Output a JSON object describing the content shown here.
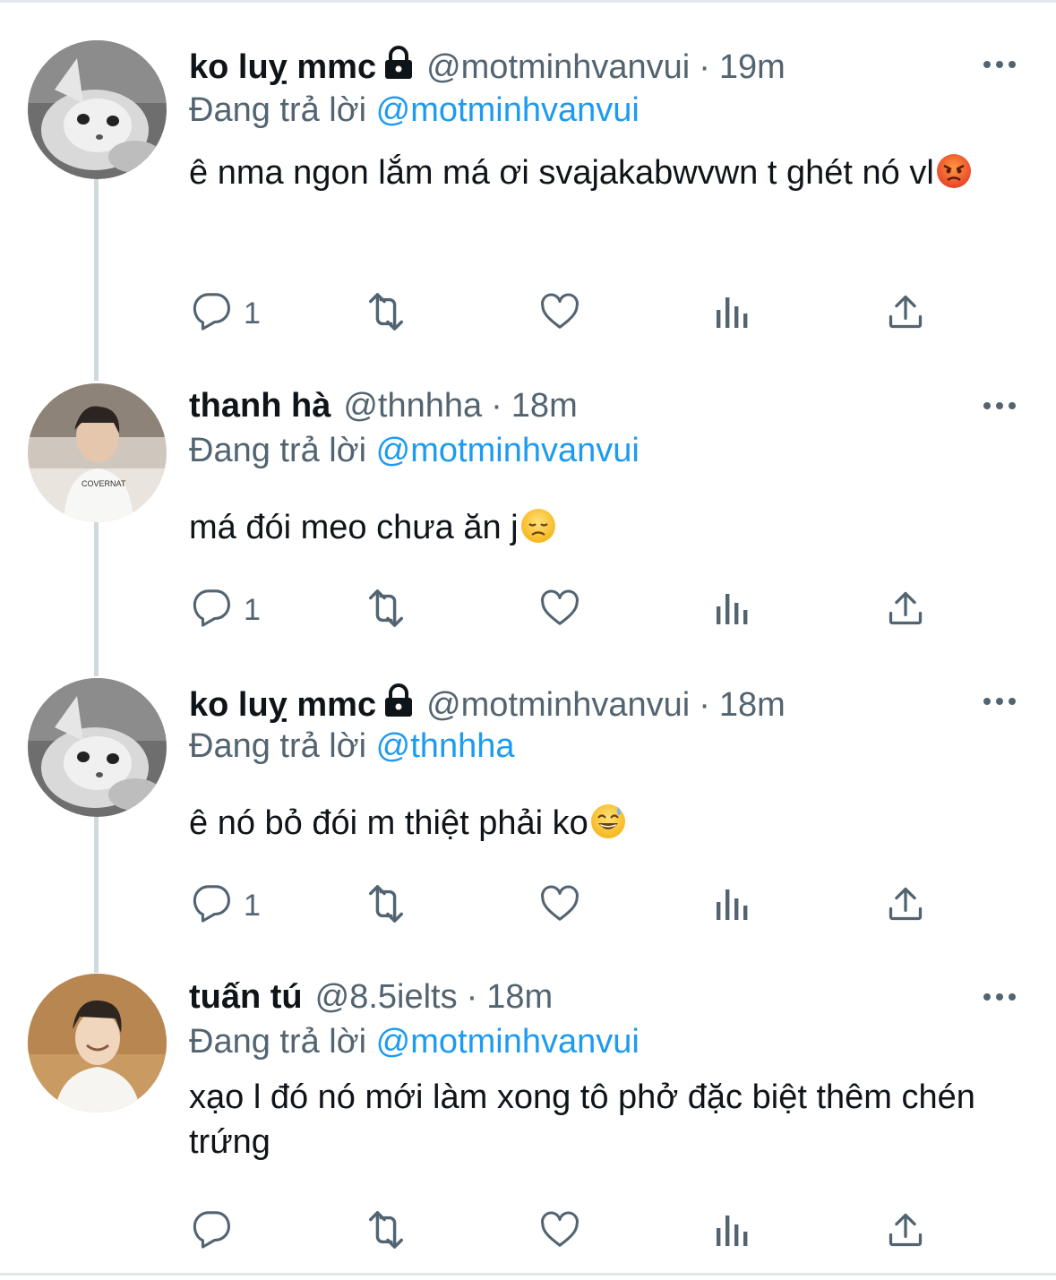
{
  "tweets": [
    {
      "name": "ko luỵ mmc",
      "handle": "@motminhvanvui",
      "separator": "·",
      "time": "19m",
      "reply_prefix": "Đang trả lời",
      "reply_to": "@motminhvanvui",
      "text": "ê nma ngon lắm má ơi svajakabwvwn t ghét nó vl",
      "emoji": "angry-face-emoji",
      "locked": true,
      "reply_count": "1"
    },
    {
      "name": "thanh hà",
      "handle": "@thnhha",
      "separator": "·",
      "time": "18m",
      "reply_prefix": "Đang trả lời",
      "reply_to": "@motminhvanvui",
      "text": "má đói meo chưa ăn j",
      "emoji": "disappointed-face-emoji",
      "locked": false,
      "reply_count": "1"
    },
    {
      "name": "ko luỵ mmc",
      "handle": "@motminhvanvui",
      "separator": "·",
      "time": "18m",
      "reply_prefix": "Đang trả lời",
      "reply_to": "@thnhha",
      "text": "ê nó bỏ đói m thiệt phải ko",
      "emoji": "grinning-sweat-face-emoji",
      "locked": true,
      "reply_count": "1"
    },
    {
      "name": "tuấn tú",
      "handle": "@8.5ielts",
      "separator": "·",
      "time": "18m",
      "reply_prefix": "Đang trả lời",
      "reply_to": "@motminhvanvui",
      "text": "xạo l đó nó mới làm xong tô phở đặc biệt thêm chén trứng",
      "emoji": "",
      "locked": false,
      "reply_count": ""
    }
  ],
  "icons": {
    "reply": "reply-icon",
    "retweet": "retweet-icon",
    "like": "like-icon",
    "views": "views-icon",
    "share": "share-icon",
    "more": "more-icon",
    "lock": "lock-icon"
  },
  "colors": {
    "text": "#0f1419",
    "secondary": "#536471",
    "mention": "#1d9bf0",
    "thread_line": "#cfd9de"
  }
}
